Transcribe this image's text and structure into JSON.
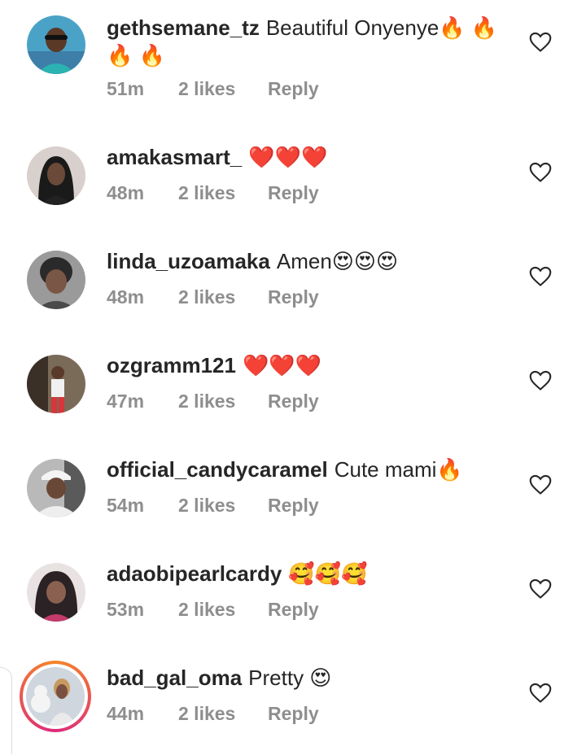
{
  "comments": [
    {
      "username": "gethsemane_tz",
      "text": "Beautiful Onyenye🔥 🔥 🔥 🔥",
      "time": "51m",
      "likes": "2 likes",
      "reply": "Reply"
    },
    {
      "username": "amakasmart_",
      "text": "❤️❤️❤️",
      "time": "48m",
      "likes": "2 likes",
      "reply": "Reply"
    },
    {
      "username": "linda_uzoamaka",
      "text": "Amen😍😍😍",
      "time": "48m",
      "likes": "2 likes",
      "reply": "Reply"
    },
    {
      "username": "ozgramm121",
      "text": "❤️❤️❤️",
      "time": "47m",
      "likes": "2 likes",
      "reply": "Reply"
    },
    {
      "username": "official_candycaramel",
      "text": "Cute mami🔥",
      "time": "54m",
      "likes": "2 likes",
      "reply": "Reply"
    },
    {
      "username": "adaobipearlcardy",
      "text": "🥰🥰🥰",
      "time": "53m",
      "likes": "2 likes",
      "reply": "Reply"
    },
    {
      "username": "bad_gal_oma",
      "text": "Pretty 😍",
      "time": "44m",
      "likes": "2 likes",
      "reply": "Reply"
    }
  ],
  "colors": {
    "text": "#262626",
    "meta": "#8e8e8e",
    "story_ring_start": "#f58529",
    "story_ring_end": "#dd2a7b"
  },
  "icons": {
    "like": "heart-outline-icon"
  }
}
